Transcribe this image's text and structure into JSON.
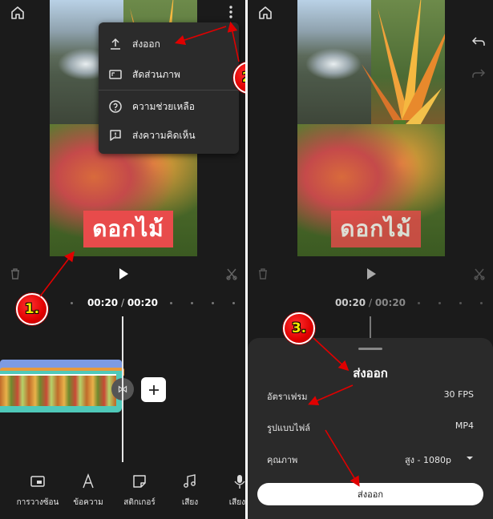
{
  "left_panel": {
    "menu": {
      "items": [
        {
          "label": "ส่งออก",
          "icon": "upload-icon"
        },
        {
          "label": "สัดส่วนภาพ",
          "icon": "aspect-ratio-icon"
        },
        {
          "label": "ความช่วยเหลือ",
          "icon": "help-icon"
        },
        {
          "label": "ส่งความคิดเห็น",
          "icon": "feedback-icon"
        }
      ]
    },
    "caption": "ดอกไม้",
    "time": {
      "current": "00:20",
      "separator": " / ",
      "total": "00:20"
    },
    "toolbar": [
      {
        "label": "การวางซ้อน",
        "icon": "overlay-icon"
      },
      {
        "label": "ข้อความ",
        "icon": "text-icon"
      },
      {
        "label": "สติกเกอร์",
        "icon": "sticker-icon"
      },
      {
        "label": "เสียง",
        "icon": "music-icon"
      },
      {
        "label": "เสียงบ",
        "icon": "microphone-icon"
      }
    ]
  },
  "right_panel": {
    "caption": "ดอกไม้",
    "time": {
      "current": "00:20",
      "separator": " / ",
      "total": "00:20"
    },
    "export_sheet": {
      "title": "ส่งออก",
      "rows": [
        {
          "label": "อัตราเฟรม",
          "value": "30 FPS"
        },
        {
          "label": "รูปแบบไฟล์",
          "value": "MP4"
        },
        {
          "label": "คุณภาพ",
          "value": "สูง - 1080p"
        }
      ],
      "button": "ส่งออก"
    }
  },
  "markers": [
    "1.",
    "2.",
    "3."
  ],
  "colors": {
    "background": "#1b1b1b",
    "menu": "#2b2b2b",
    "caption": "#e84b4b",
    "marker": "#e00000",
    "marker_text": "#f6e600",
    "clip_teal": "#4fc9b9",
    "clip_blue": "#7d9be3"
  }
}
